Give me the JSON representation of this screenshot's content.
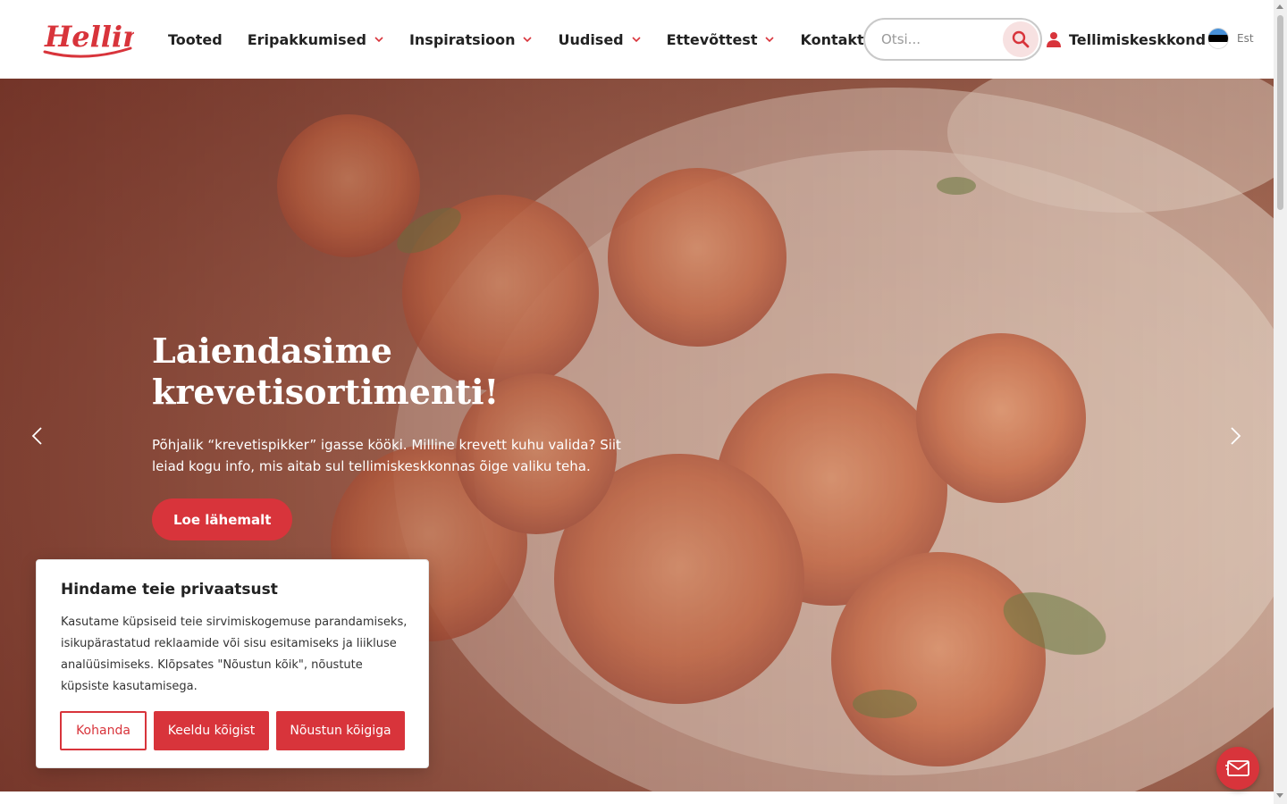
{
  "brand": {
    "logo_text": "Hellin",
    "accent_color": "#d8343b"
  },
  "nav": {
    "items": [
      {
        "label": "Tooted",
        "has_dropdown": false
      },
      {
        "label": "Eripakkumised",
        "has_dropdown": true
      },
      {
        "label": "Inspiratsioon",
        "has_dropdown": true
      },
      {
        "label": "Uudised",
        "has_dropdown": true
      },
      {
        "label": "Ettevõttest",
        "has_dropdown": true
      },
      {
        "label": "Kontakt",
        "has_dropdown": false
      }
    ]
  },
  "search": {
    "placeholder": "Otsi...",
    "icon": "search-icon"
  },
  "account": {
    "label": "Tellimiskeskkond",
    "icon": "user-icon"
  },
  "language": {
    "label": "Est",
    "flag_colors": [
      "#4891d9",
      "#000000",
      "#ffffff"
    ]
  },
  "hero": {
    "title": "Laiendasime krevetisortimenti!",
    "text": "Põhjalik “krevetispikker” igasse kööki. Milline krevett kuhu valida? Siit leiad kogu info, mis aitab sul tellimiskeskkonnas õige valiku teha.",
    "button_label": "Loe lähemalt"
  },
  "cookie": {
    "title": "Hindame teie privaatsust",
    "text": "Kasutame küpsiseid teie sirvimiskogemuse parandamiseks, isikupärastatud reklaamide või sisu esitamiseks ja liikluse analüüsimiseks. Klõpsates \"Nõustun kõik\", nõustute küpsiste kasutamisega.",
    "customize_label": "Kohanda",
    "reject_label": "Keeldu kõigist",
    "accept_label": "Nõustun kõigiga"
  },
  "chat": {
    "icon": "envelope-icon"
  }
}
